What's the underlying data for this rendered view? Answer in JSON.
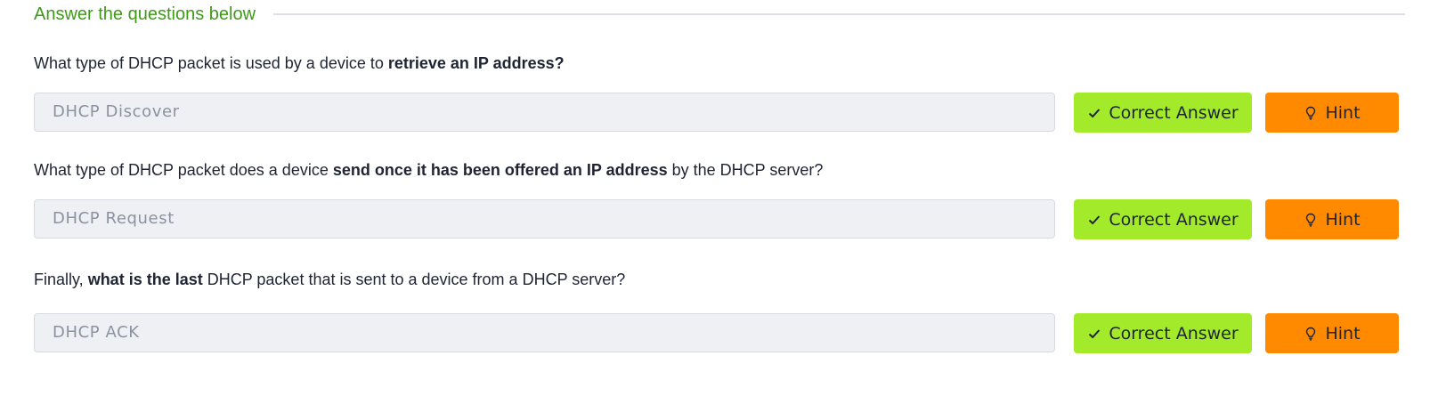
{
  "section": {
    "title": "Answer the questions below"
  },
  "questions": [
    {
      "parts": [
        {
          "text": "What type of DHCP packet is used by a device to ",
          "bold": false
        },
        {
          "text": "retrieve an IP address?",
          "bold": true
        }
      ],
      "answer_value": "DHCP Discover",
      "correct_label": "Correct Answer",
      "hint_label": "Hint"
    },
    {
      "parts": [
        {
          "text": "What type of DHCP packet does a device ",
          "bold": false
        },
        {
          "text": "send once it has been offered an IP address",
          "bold": true
        },
        {
          "text": " by the DHCP server?",
          "bold": false
        }
      ],
      "answer_value": "DHCP Request",
      "correct_label": "Correct Answer",
      "hint_label": "Hint"
    },
    {
      "parts": [
        {
          "text": "Finally, ",
          "bold": false
        },
        {
          "text": "what is the last",
          "bold": true
        },
        {
          "text": " DHCP packet that is sent to a device from a DHCP server?",
          "bold": false
        }
      ],
      "answer_value": "DHCP ACK",
      "correct_label": "Correct Answer",
      "hint_label": "Hint"
    }
  ],
  "icons": {
    "correct": "check-icon",
    "hint": "lightbulb-icon"
  },
  "colors": {
    "title_green": "#3e9a18",
    "correct_button": "#a3ea2a",
    "hint_button": "#ff8a00",
    "answer_field_bg": "#eef0f4"
  }
}
